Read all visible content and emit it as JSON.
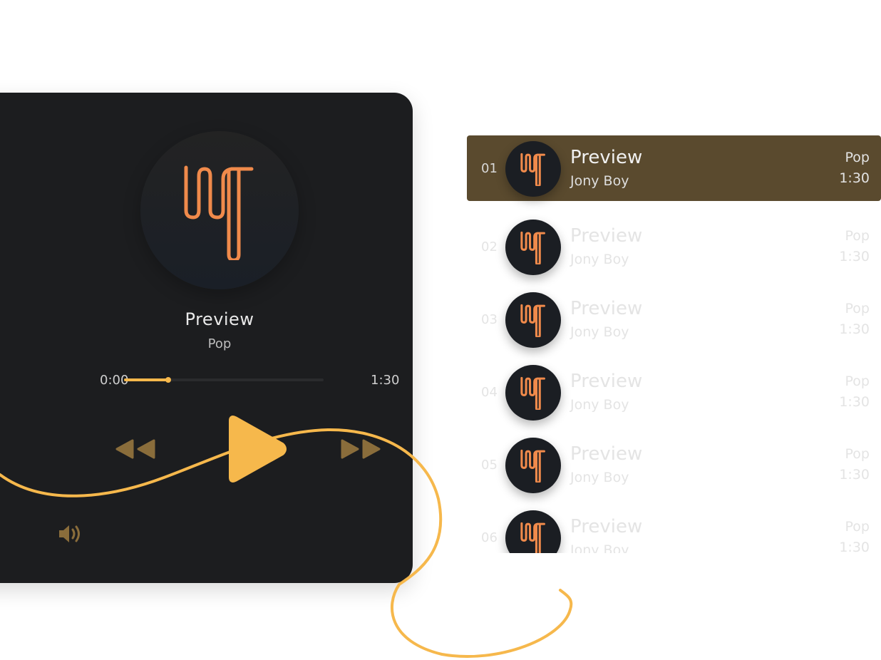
{
  "player": {
    "title": "Preview",
    "genre": "Pop",
    "elapsed": "0:00",
    "duration": "1:30",
    "progress": 0.22
  },
  "colors": {
    "accent": "#f6b84c",
    "logo": "#f08a4b",
    "panel": "#1c1d1f",
    "active_row": "#5a4a2e",
    "muted_control": "#8a6d3b"
  },
  "icons": {
    "rewind": "rewind-icon",
    "play": "play-icon",
    "forward": "fast-forward-icon",
    "volume": "volume-icon",
    "logo": "waveform-logo-icon"
  },
  "playlist": [
    {
      "num": "01",
      "title": "Preview",
      "artist": "Jony Boy",
      "genre": "Pop",
      "duration": "1:30",
      "active": true
    },
    {
      "num": "02",
      "title": "Preview",
      "artist": "Jony Boy",
      "genre": "Pop",
      "duration": "1:30",
      "active": false
    },
    {
      "num": "03",
      "title": "Preview",
      "artist": "Jony Boy",
      "genre": "Pop",
      "duration": "1:30",
      "active": false
    },
    {
      "num": "04",
      "title": "Preview",
      "artist": "Jony Boy",
      "genre": "Pop",
      "duration": "1:30",
      "active": false
    },
    {
      "num": "05",
      "title": "Preview",
      "artist": "Jony Boy",
      "genre": "Pop",
      "duration": "1:30",
      "active": false
    },
    {
      "num": "06",
      "title": "Preview",
      "artist": "Jony Boy",
      "genre": "Pop",
      "duration": "1:30",
      "active": false
    }
  ]
}
